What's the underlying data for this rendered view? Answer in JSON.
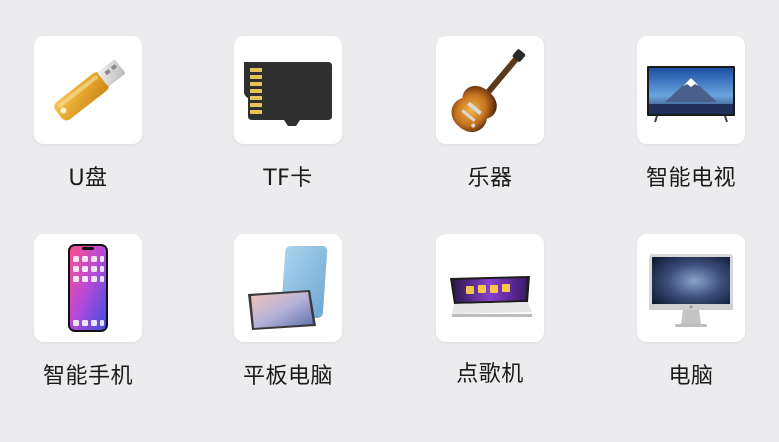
{
  "devices": [
    {
      "label": "U盘",
      "icon": "usb-drive-icon"
    },
    {
      "label": "TF卡",
      "icon": "tf-card-icon"
    },
    {
      "label": "乐器",
      "icon": "guitar-icon"
    },
    {
      "label": "智能电视",
      "icon": "smart-tv-icon"
    },
    {
      "label": "智能手机",
      "icon": "smartphone-icon"
    },
    {
      "label": "平板电脑",
      "icon": "tablet-icon"
    },
    {
      "label": "点歌机",
      "icon": "karaoke-machine-icon"
    },
    {
      "label": "电脑",
      "icon": "computer-icon"
    }
  ],
  "colors": {
    "background": "#ececee",
    "tile": "#ffffff",
    "text": "#1b1b1b"
  }
}
